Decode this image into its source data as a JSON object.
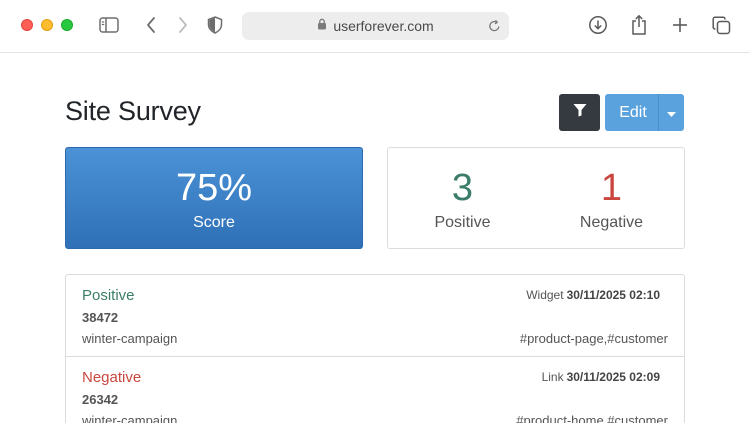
{
  "browser": {
    "url": "userforever.com"
  },
  "page": {
    "title": "Site Survey",
    "edit_label": "Edit"
  },
  "summary": {
    "score_value": "75%",
    "score_label": "Score",
    "positive_count": "3",
    "positive_label": "Positive",
    "negative_count": "1",
    "negative_label": "Negative"
  },
  "responses": [
    {
      "sentiment": "Positive",
      "id": "38472",
      "campaign": "winter-campaign",
      "source": "Widget",
      "datetime": "30/11/2025 02:10",
      "tags": "#product-page,#customer"
    },
    {
      "sentiment": "Negative",
      "id": "26342",
      "campaign": "winter-campaign",
      "source": "Link",
      "datetime": "30/11/2025 02:09",
      "tags": "#product-home,#customer"
    }
  ],
  "colors": {
    "positive": "#3b7d6a",
    "negative": "#c9473f",
    "primary": "#5aa2dd",
    "dark_button": "#343a40"
  }
}
